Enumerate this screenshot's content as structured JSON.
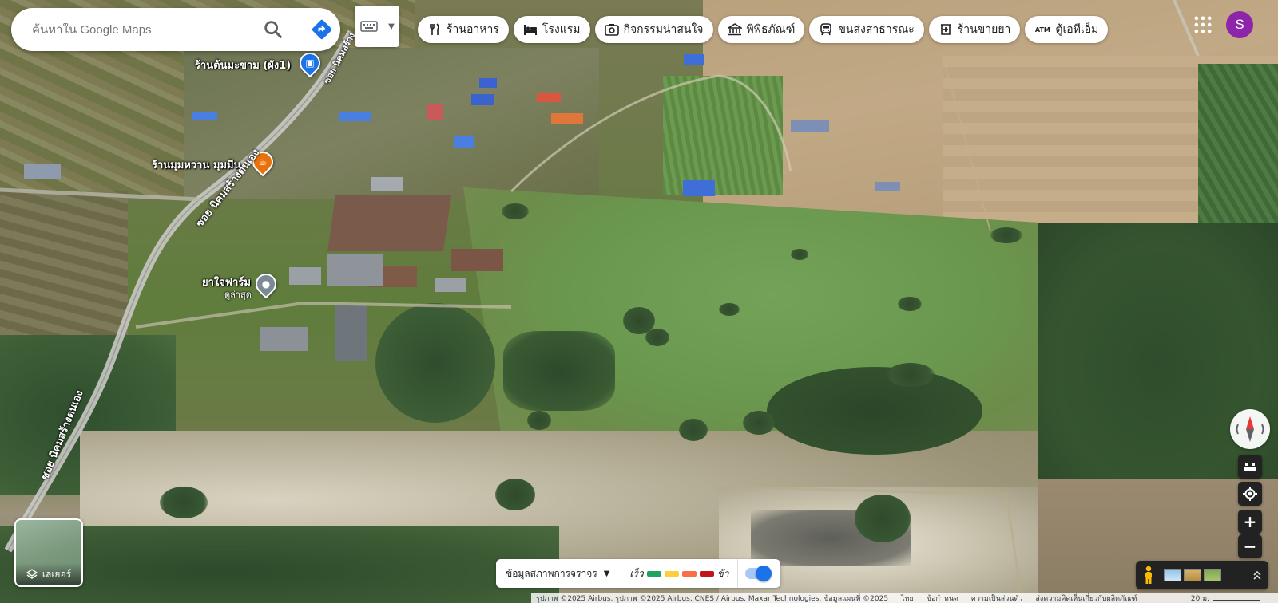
{
  "search": {
    "placeholder": "ค้นหาใน Google Maps"
  },
  "chips": [
    {
      "label": "ร้านอาหาร",
      "icon": "restaurant-icon"
    },
    {
      "label": "โรงแรม",
      "icon": "hotel-icon"
    },
    {
      "label": "กิจกรรมน่าสนใจ",
      "icon": "camera-icon"
    },
    {
      "label": "พิพิธภัณฑ์",
      "icon": "museum-icon"
    },
    {
      "label": "ขนส่งสาธารณะ",
      "icon": "transit-icon"
    },
    {
      "label": "ร้านขายยา",
      "icon": "pharmacy-icon"
    },
    {
      "label": "ตู้เอทีเอ็ม",
      "icon": "atm-icon",
      "icon_text": "ATM"
    }
  ],
  "account": {
    "initial": "S",
    "color": "#8e24aa"
  },
  "map_labels": {
    "poi_1": "ร้านต้นมะขาม (ผัง1)",
    "poi_2": "ร้านมุมหวาน มุมมีน",
    "poi_3": "ยาใจฟาร์ม",
    "poi_3_sub": "ดูล่าสุด",
    "road_1": "ซอย นิคมสร้างตนเอง",
    "road_2": "ซอย นิคมสร้างตนเอง",
    "road_3": "ซอย นิคมสร้าง"
  },
  "layers": {
    "label": "เลเยอร์"
  },
  "traffic": {
    "label": "ข้อมูลสภาพการจราจร",
    "fast": "เร็ว",
    "slow": "ช้า",
    "colors": [
      "#1ea362",
      "#ffcd3d",
      "#f96d49",
      "#c2151b"
    ],
    "toggle_on": true
  },
  "footer": {
    "attribution": "รูปภาพ ©2025 Airbus, รูปภาพ ©2025 Airbus, CNES / Airbus, Maxar Technologies, ข้อมูลแผนที่ ©2025",
    "links": [
      "ไทย",
      "ข้อกำหนด",
      "ความเป็นส่วนตัว",
      "ส่งความคิดเห็นเกี่ยวกับผลิตภัณฑ์"
    ],
    "scale": "20 ม."
  },
  "colors": {
    "accent": "#1a73e8",
    "pin_blue": "#1a73e8",
    "pin_orange": "#e8710a",
    "pin_gray": "#7b8a96"
  }
}
